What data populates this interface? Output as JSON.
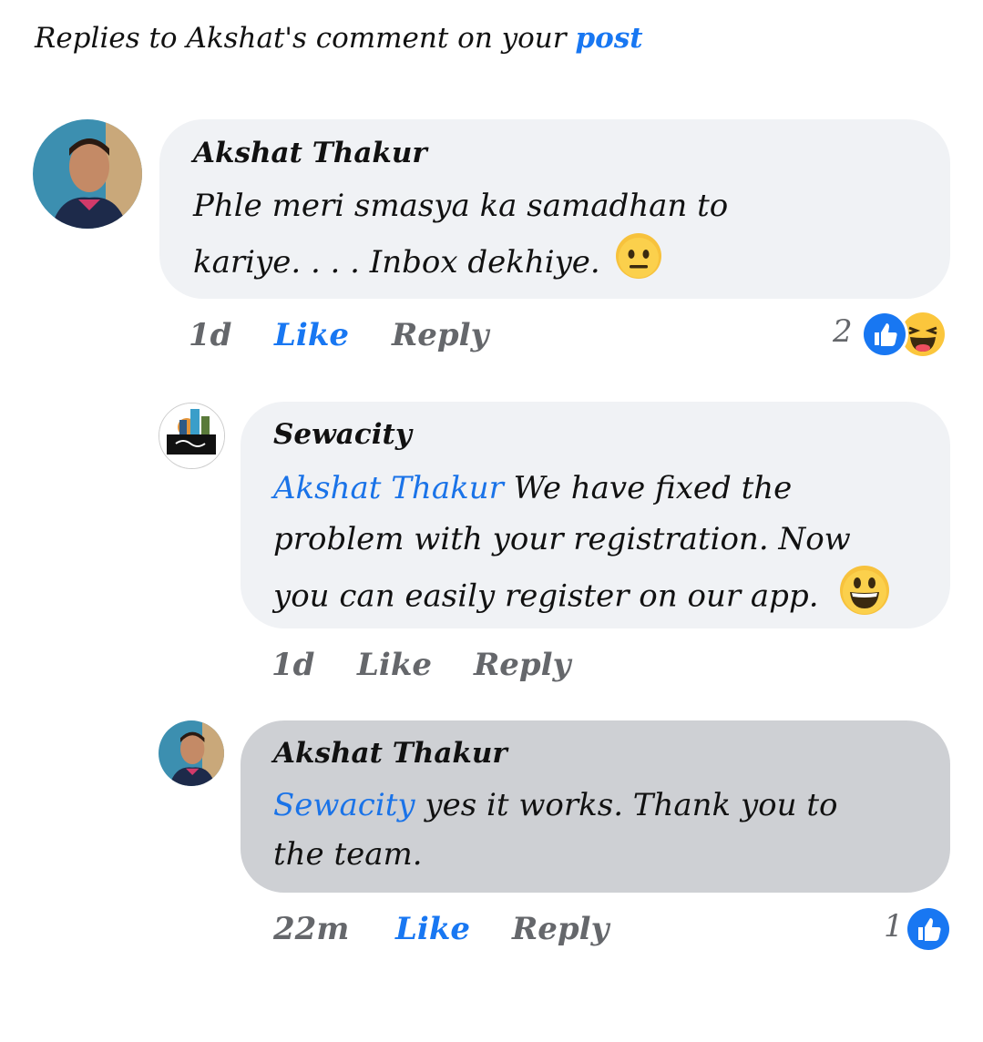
{
  "header": {
    "text": "Replies to Akshat's comment on your",
    "link": "post"
  },
  "comments": [
    {
      "author": "Akshat Thakur",
      "line1": "Phle meri smasya ka samadhan to",
      "line2": "kariye. . . .  Inbox dekhiye.",
      "emoji": "neutral-face",
      "time": "1d",
      "like": "Like",
      "reply": "Reply",
      "reaction_count": "2",
      "reactions": [
        "like",
        "haha"
      ]
    },
    {
      "author": "Sewacity",
      "mention": "Akshat Thakur",
      "line1_rest": " We have fixed the",
      "line2": "problem with your registration. Now",
      "line3": "you can easily register on our app.",
      "emoji": "grinning-face",
      "time": "1d",
      "like": "Like",
      "reply": "Reply"
    },
    {
      "author": "Akshat Thakur",
      "mention": "Sewacity",
      "line1_rest": " yes it works.  Thank you to",
      "line2": "the team.",
      "time": "22m",
      "like": "Like",
      "reply": "Reply",
      "reaction_count": "1",
      "reactions": [
        "like"
      ]
    }
  ],
  "colors": {
    "link_blue": "#1877f2",
    "bubble": "#f0f2f5",
    "bubble_highlight": "#ced0d4",
    "meta_gray": "#65676b"
  }
}
